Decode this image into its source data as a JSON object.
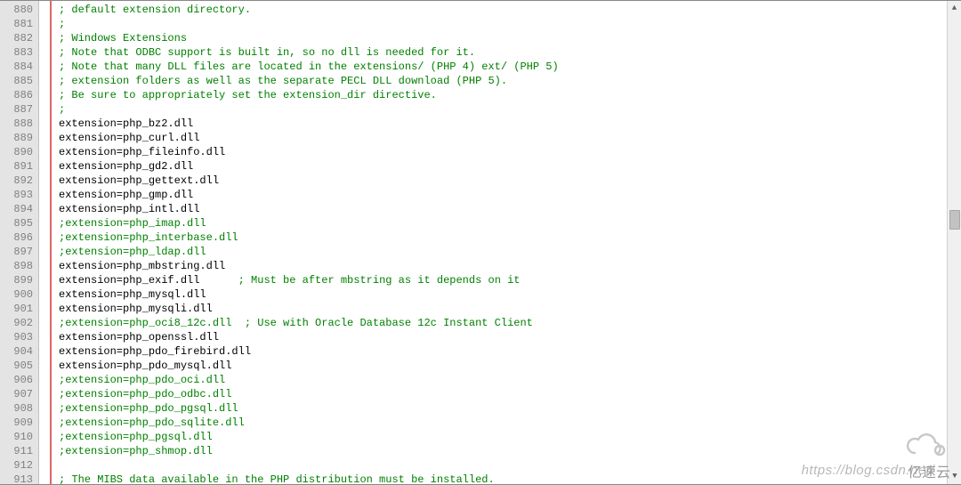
{
  "watermark_url": "https://blog.csdn.net/",
  "watermark_brand": "亿速云",
  "lines": [
    {
      "n": 880,
      "type": "comment",
      "text": "; default extension directory."
    },
    {
      "n": 881,
      "type": "comment",
      "text": ";"
    },
    {
      "n": 882,
      "type": "comment",
      "text": "; Windows Extensions"
    },
    {
      "n": 883,
      "type": "comment",
      "text": "; Note that ODBC support is built in, so no dll is needed for it."
    },
    {
      "n": 884,
      "type": "comment",
      "text": "; Note that many DLL files are located in the extensions/ (PHP 4) ext/ (PHP 5)"
    },
    {
      "n": 885,
      "type": "comment",
      "text": "; extension folders as well as the separate PECL DLL download (PHP 5)."
    },
    {
      "n": 886,
      "type": "comment",
      "text": "; Be sure to appropriately set the extension_dir directive."
    },
    {
      "n": 887,
      "type": "comment",
      "text": ";"
    },
    {
      "n": 888,
      "type": "code",
      "text": "extension=php_bz2.dll"
    },
    {
      "n": 889,
      "type": "code",
      "text": "extension=php_curl.dll"
    },
    {
      "n": 890,
      "type": "code",
      "text": "extension=php_fileinfo.dll"
    },
    {
      "n": 891,
      "type": "code",
      "text": "extension=php_gd2.dll"
    },
    {
      "n": 892,
      "type": "code",
      "text": "extension=php_gettext.dll"
    },
    {
      "n": 893,
      "type": "code",
      "text": "extension=php_gmp.dll"
    },
    {
      "n": 894,
      "type": "code",
      "text": "extension=php_intl.dll"
    },
    {
      "n": 895,
      "type": "comment",
      "text": ";extension=php_imap.dll"
    },
    {
      "n": 896,
      "type": "comment",
      "text": ";extension=php_interbase.dll"
    },
    {
      "n": 897,
      "type": "comment",
      "text": ";extension=php_ldap.dll"
    },
    {
      "n": 898,
      "type": "code",
      "text": "extension=php_mbstring.dll"
    },
    {
      "n": 899,
      "type": "mixed",
      "text": "extension=php_exif.dll      ",
      "trail": "; Must be after mbstring as it depends on it"
    },
    {
      "n": 900,
      "type": "code",
      "text": "extension=php_mysql.dll"
    },
    {
      "n": 901,
      "type": "code",
      "text": "extension=php_mysqli.dll"
    },
    {
      "n": 902,
      "type": "comment",
      "text": ";extension=php_oci8_12c.dll  ; Use with Oracle Database 12c Instant Client"
    },
    {
      "n": 903,
      "type": "code",
      "text": "extension=php_openssl.dll"
    },
    {
      "n": 904,
      "type": "code",
      "text": "extension=php_pdo_firebird.dll"
    },
    {
      "n": 905,
      "type": "code",
      "text": "extension=php_pdo_mysql.dll"
    },
    {
      "n": 906,
      "type": "comment",
      "text": ";extension=php_pdo_oci.dll"
    },
    {
      "n": 907,
      "type": "comment",
      "text": ";extension=php_pdo_odbc.dll"
    },
    {
      "n": 908,
      "type": "comment",
      "text": ";extension=php_pdo_pgsql.dll"
    },
    {
      "n": 909,
      "type": "comment",
      "text": ";extension=php_pdo_sqlite.dll"
    },
    {
      "n": 910,
      "type": "comment",
      "text": ";extension=php_pgsql.dll"
    },
    {
      "n": 911,
      "type": "comment",
      "text": ";extension=php_shmop.dll"
    },
    {
      "n": 912,
      "type": "code",
      "text": ""
    },
    {
      "n": 913,
      "type": "comment",
      "text": "; The MIBS data available in the PHP distribution must be installed."
    }
  ]
}
